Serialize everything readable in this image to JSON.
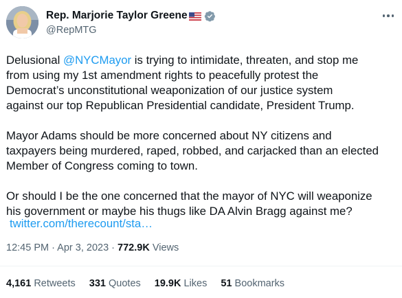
{
  "author": {
    "display_name": "Rep. Marjorie Taylor Greene",
    "handle": "@RepMTG",
    "flag_icon": "us-flag-icon",
    "verified_icon": "verified-badge-icon",
    "verified_color": "#829aab"
  },
  "tweet": {
    "paragraph1": {
      "prefix": "Delusional ",
      "mention": "@NYCMayor",
      "suffix": " is trying to intimidate, threaten, and stop me\nfrom using my 1st amendment rights to peacefully protest the\nDemocrat’s unconstitutional weaponization of our justice system\nagainst our top Republican Presidential candidate, President Trump."
    },
    "paragraph2": "Mayor Adams should be more concerned about NY citizens and\ntaxpayers being murdered, raped, robbed, and carjacked than an elected\nMember of Congress coming to town.",
    "paragraph3": "Or should I be the one concerned that the mayor of NYC will weaponize\nhis government or maybe his thugs like DA Alvin Bragg against me?",
    "link": "twitter.com/therecount/sta…"
  },
  "meta": {
    "time": "12:45 PM",
    "separator": " · ",
    "date": "Apr 3, 2023",
    "views_count": "772.9K",
    "views_label": " Views"
  },
  "stats": {
    "retweets_count": "4,161",
    "retweets_label": " Retweets",
    "quotes_count": "331",
    "quotes_label": " Quotes",
    "likes_count": "19.9K",
    "likes_label": " Likes",
    "bookmarks_count": "51",
    "bookmarks_label": " Bookmarks"
  },
  "colors": {
    "link": "#1d9bf0",
    "text": "#0f1419",
    "secondary": "#536471",
    "divider": "#eff3f4"
  }
}
